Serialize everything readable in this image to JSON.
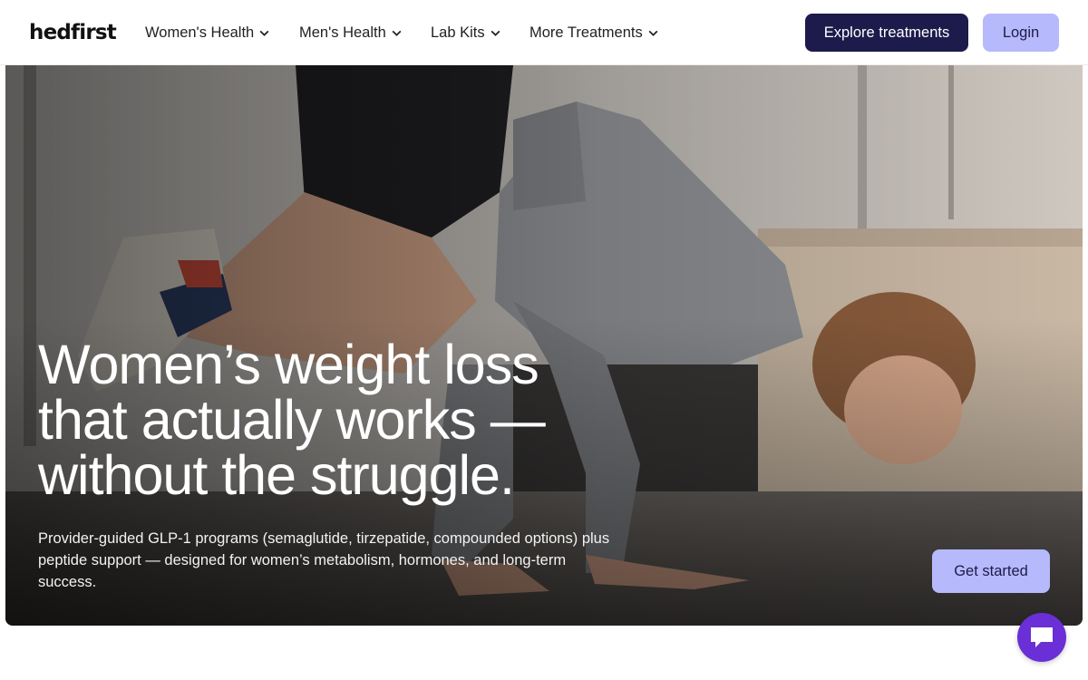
{
  "header": {
    "logo": "hedfirst",
    "nav": [
      {
        "label": "Women's Health",
        "icon": "chevron-down-icon"
      },
      {
        "label": "Men's Health",
        "icon": "chevron-down-icon"
      },
      {
        "label": "Lab Kits",
        "icon": "chevron-down-icon"
      },
      {
        "label": "More Treatments",
        "icon": "chevron-down-icon"
      }
    ],
    "explore_label": "Explore treatments",
    "login_label": "Login"
  },
  "hero": {
    "title_line1": "Women’s weight loss",
    "title_line2": "that actually works —",
    "title_line3": "without the struggle.",
    "subtitle": "Provider-guided GLP-1 programs (semaglutide, tirzepatide, compounded options) plus peptide support — designed for women’s metabolism, hormones, and long-term success.",
    "cta_label": "Get started",
    "image": "woman-crow-pose-gym-photo"
  },
  "chat": {
    "icon": "chat-bubble-icon"
  },
  "colors": {
    "navy": "#1d1b4b",
    "lavender": "#b6b9fb",
    "chat_purple": "#6a2fd6"
  }
}
